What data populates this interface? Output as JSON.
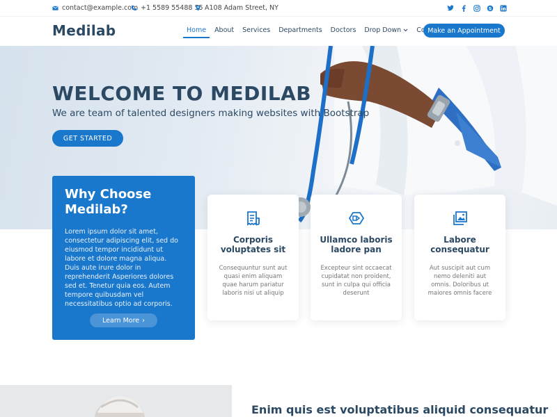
{
  "topbar": {
    "email": "contact@example.com",
    "phone": "+1 5589 55488 55",
    "address": "A108 Adam Street, NY",
    "social_icons": [
      "twitter-icon",
      "facebook-icon",
      "instagram-icon",
      "skype-icon",
      "linkedin-icon"
    ]
  },
  "header": {
    "logo": "Medilab",
    "nav": [
      "Home",
      "About",
      "Services",
      "Departments",
      "Doctors",
      "Drop Down",
      "Contact"
    ],
    "appointment_label": "Make an Appointment"
  },
  "hero": {
    "title": "WELCOME TO MEDILAB",
    "subtitle": "We are team of talented designers making websites with Bootstrap",
    "cta": "GET STARTED"
  },
  "why": {
    "title": "Why Choose Medilab?",
    "text": "Lorem ipsum dolor sit amet, consectetur adipiscing elit, sed do eiusmod tempor incididunt ut labore et dolore magna aliqua. Duis aute irure dolor in reprehenderit Asperiores dolores sed et. Tenetur quia eos. Autem tempore quibusdam vel necessitatibus optio ad corporis.",
    "more": "Learn More",
    "more_chevron": "›"
  },
  "cards": [
    {
      "icon": "receipt-icon",
      "title": "Corporis voluptates sit",
      "text": "Consequuntur sunt aut quasi enim aliquam quae harum pariatur laboris nisi ut aliquip"
    },
    {
      "icon": "cube-icon",
      "title": "Ullamco laboris ladore pan",
      "text": "Excepteur sint occaecat cupidatat non proident, sunt in culpa qui officia deserunt"
    },
    {
      "icon": "images-icon",
      "title": "Labore consequatur",
      "text": "Aut suscipit aut cum nemo deleniti aut omnis. Doloribus ut maiores omnis facere"
    }
  ],
  "about": {
    "title": "Enim quis est voluptatibus aliquid consequatur"
  },
  "colors": {
    "accent": "#1977cc",
    "heading": "#2c4964"
  }
}
